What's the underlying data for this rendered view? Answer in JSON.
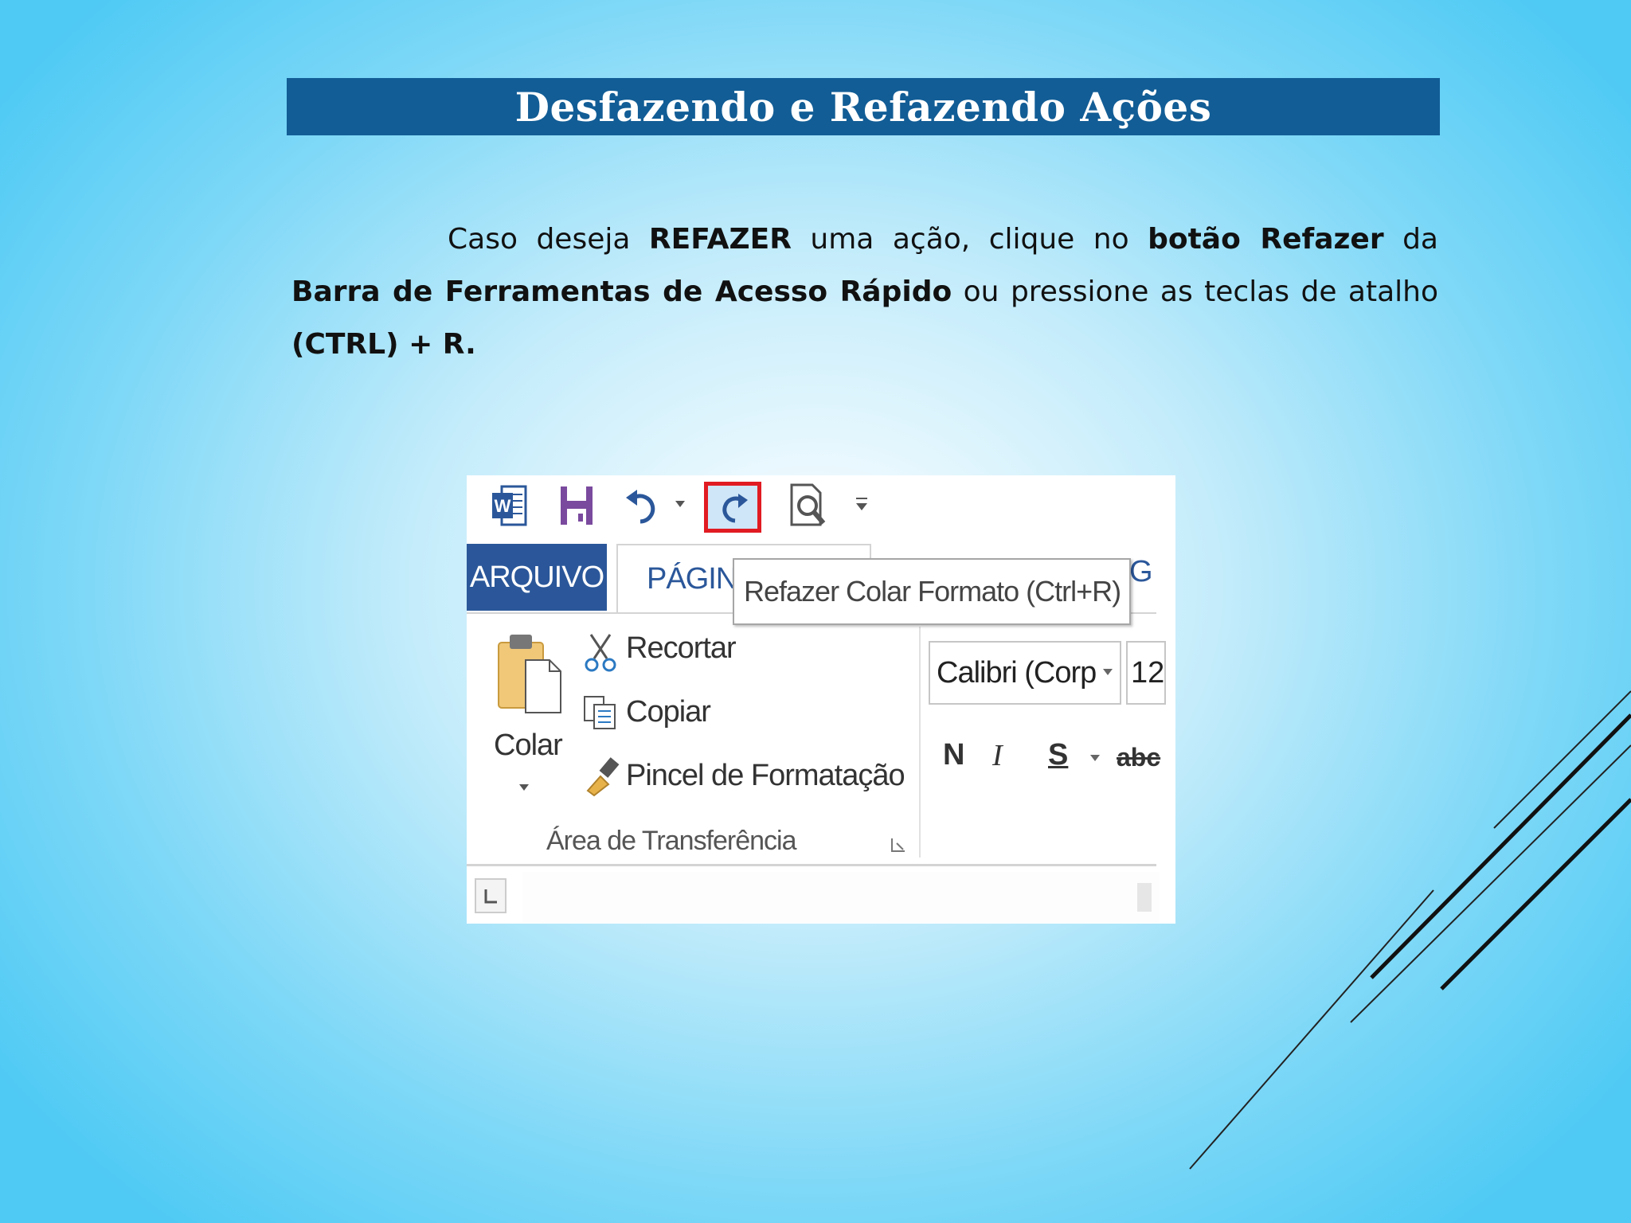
{
  "slide": {
    "title": "Desfazendo e Refazendo Ações",
    "paragraph": {
      "t1": "Caso deseja ",
      "b1": "REFAZER",
      "t2": " uma ação, clique no ",
      "b2": "botão Refazer",
      "t3": " da ",
      "b3": "Barra de Ferramentas de Acesso Rápido",
      "t4": " ou pressione as teclas de atalho ",
      "b4": "(CTRL) + R."
    }
  },
  "screenshot": {
    "tabs": {
      "arquivo": "ARQUIVO",
      "pagina": "PÁGINA",
      "next": "GI"
    },
    "tooltip": "Refazer Colar Formato (Ctrl+R)",
    "clipboard": {
      "paste_label": "Colar",
      "cut_label": "Recortar",
      "copy_label": "Copiar",
      "format_painter_label": "Pincel de Formatação",
      "group_label": "Área de Transferência"
    },
    "font": {
      "name": "Calibri (Corp",
      "size": "12",
      "bold": "N",
      "italic": "I",
      "underline": "S",
      "strike": "abc"
    }
  },
  "colors": {
    "title_bar": "#125d96",
    "ribbon_blue": "#2b579a",
    "highlight_border": "#e11b22"
  }
}
